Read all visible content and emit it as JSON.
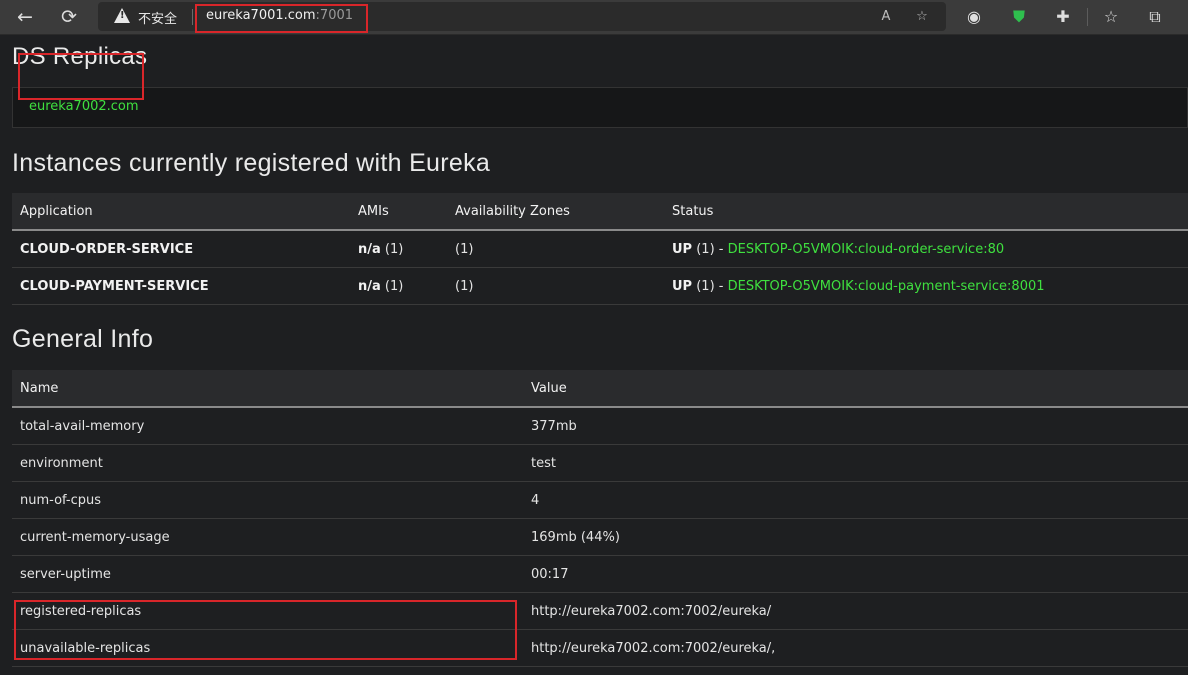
{
  "browser": {
    "insecure_label": "不安全",
    "url_host": "eureka7001.com",
    "url_port": ":7001",
    "icons": [
      "back-icon",
      "refresh-icon",
      "warning-icon",
      "read-aloud-icon",
      "add-favorite-icon",
      "extension-avatar-icon",
      "shield-icon",
      "extensions-icon",
      "favorites-icon",
      "collections-icon"
    ]
  },
  "ds_replicas": {
    "title": "DS Replicas",
    "link": "eureka7002.com"
  },
  "instances": {
    "title": "Instances currently registered with Eureka",
    "headers": [
      "Application",
      "AMIs",
      "Availability Zones",
      "Status"
    ],
    "rows": [
      {
        "app": "CLOUD-ORDER-SERVICE",
        "ami_bold": "n/a",
        "ami_count": "(1)",
        "zones": "(1)",
        "status_bold": "UP",
        "status_count": "(1) -",
        "status_link": "DESKTOP-O5VMOIK:cloud-order-service:80"
      },
      {
        "app": "CLOUD-PAYMENT-SERVICE",
        "ami_bold": "n/a",
        "ami_count": "(1)",
        "zones": "(1)",
        "status_bold": "UP",
        "status_count": "(1) -",
        "status_link": "DESKTOP-O5VMOIK:cloud-payment-service:8001"
      }
    ]
  },
  "general": {
    "title": "General Info",
    "headers": [
      "Name",
      "Value"
    ],
    "rows": [
      {
        "name": "total-avail-memory",
        "value": "377mb"
      },
      {
        "name": "environment",
        "value": "test"
      },
      {
        "name": "num-of-cpus",
        "value": "4"
      },
      {
        "name": "current-memory-usage",
        "value": "169mb (44%)"
      },
      {
        "name": "server-uptime",
        "value": "00:17"
      },
      {
        "name": "registered-replicas",
        "value": "http://eureka7002.com:7002/eureka/"
      },
      {
        "name": "unavailable-replicas",
        "value": "http://eureka7002.com:7002/eureka/,"
      }
    ]
  },
  "colors": {
    "link": "#3fe03f",
    "highlight": "#d9262a",
    "background": "#1e1f21"
  }
}
